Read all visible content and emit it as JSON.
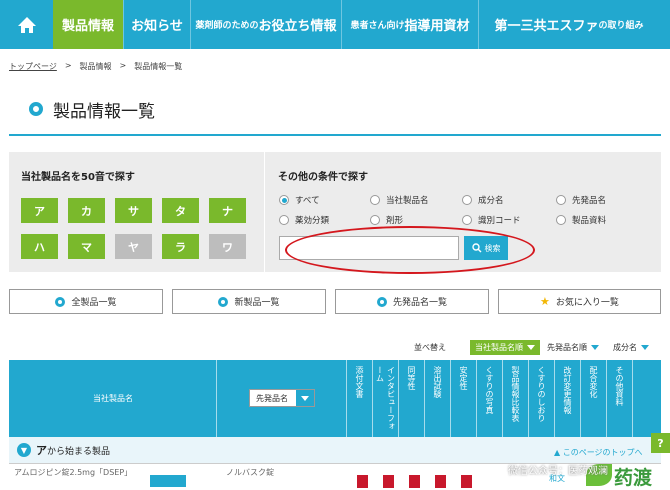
{
  "nav": {
    "items": [
      {
        "label": "製品情報"
      },
      {
        "label": "お知らせ"
      },
      {
        "small": "薬剤師のための",
        "label": "お役立ち情報"
      },
      {
        "small": "患者さん向け",
        "label": "指導用資材"
      },
      {
        "label": "第一三共エスファ",
        "small": "の取り組み"
      }
    ]
  },
  "breadcrumb": [
    "トップページ",
    ">",
    "製品情報",
    ">",
    "製品情報一覧"
  ],
  "page_title": "製品情報一覧",
  "kana_search": {
    "title": "当社製品名を50音で探す",
    "keys": [
      {
        "label": "ア",
        "enabled": true
      },
      {
        "label": "カ",
        "enabled": true
      },
      {
        "label": "サ",
        "enabled": true
      },
      {
        "label": "タ",
        "enabled": true
      },
      {
        "label": "ナ",
        "enabled": true
      },
      {
        "label": "ハ",
        "enabled": true
      },
      {
        "label": "マ",
        "enabled": true
      },
      {
        "label": "ヤ",
        "enabled": false
      },
      {
        "label": "ラ",
        "enabled": true
      },
      {
        "label": "ワ",
        "enabled": false
      }
    ]
  },
  "other_search": {
    "title": "その他の条件で探す",
    "options": [
      {
        "label": "すべて",
        "checked": true
      },
      {
        "label": "当社製品名",
        "checked": false
      },
      {
        "label": "成分名",
        "checked": false
      },
      {
        "label": "先発品名",
        "checked": false
      },
      {
        "label": "薬効分類",
        "checked": false
      },
      {
        "label": "剤形",
        "checked": false
      },
      {
        "label": "識別コード",
        "checked": false
      },
      {
        "label": "製品資料",
        "checked": false
      }
    ],
    "input_value": "",
    "button_label": "検索"
  },
  "list_buttons": [
    "全製品一覧",
    "新製品一覧",
    "先発品名一覧",
    "お気に入り一覧"
  ],
  "sort": {
    "label": "並べ替え",
    "options": [
      {
        "label": "当社製品名順",
        "active": true
      },
      {
        "label": "先発品名順",
        "active": false
      },
      {
        "label": "成分名",
        "active": false
      }
    ]
  },
  "table": {
    "col_product": "当社製品名",
    "select_value": "先発品名",
    "columns": [
      "添付文書",
      "インタビューフォーム",
      "同等性",
      "溶出試験",
      "安定性",
      "くすりの写真",
      "製品情報比較表",
      "くすりのしおり",
      "改訂変更情報",
      "配合変化",
      "その他資料"
    ]
  },
  "section": {
    "prefix": "ア",
    "label": "から始まる製品",
    "to_top": "このページのトップへ"
  },
  "row": {
    "text1": "アムロジピン錠2.5mg「DSEP」",
    "text2": "ノルバスク錠",
    "icon": "和文"
  },
  "watermark": {
    "text": "微信公众号：医药观澜",
    "brand": "药渡"
  },
  "help": "?"
}
